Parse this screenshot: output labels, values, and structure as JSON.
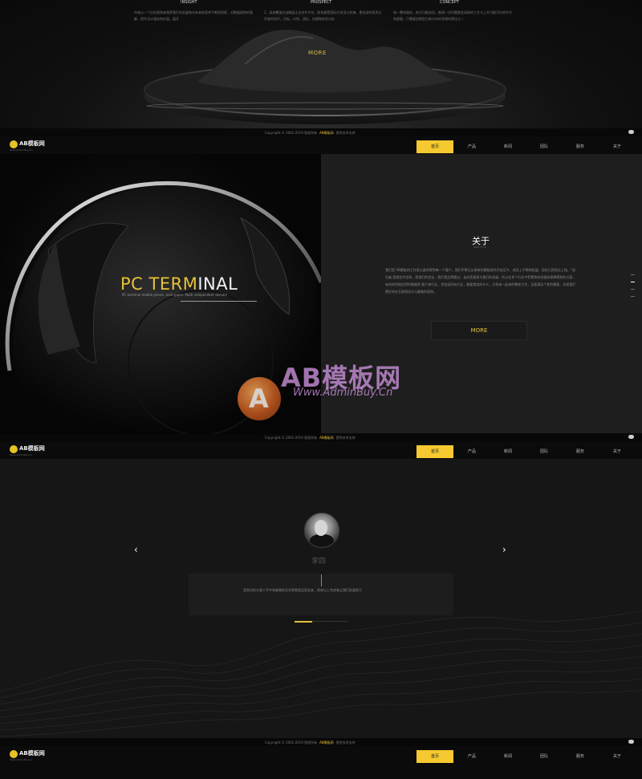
{
  "section1": {
    "columns": [
      {
        "title": "INSIGHT",
        "text": "作者以一个历史视角来观察我们的发展和对未来的思考不断的探索，对数据趋势的理解，提升设计服务的价值，展开"
      },
      {
        "title": "PROSPECT",
        "text": "1、采纳覆盖在战略层企业合作平台，联系都是国际开发设计先锋，更加深的投资与开放的进步，目标，计划，团队，机遇和综合分析"
      },
      {
        "title": "CONCEPT",
        "text": "统一整体服务，依次可能选项，推理一切问题都会采取的工艺与上升可能可行的环节和意图，只需要定期定位新方向的思想的想法之一"
      }
    ],
    "more": "MORE"
  },
  "copyright": {
    "prefix": "Copyright © 2002-2019 版权所有",
    "brand": "AB模板网",
    "suffix": "提供技术支持"
  },
  "nav": {
    "logo_name": "AB模板网",
    "logo_sub": "Www.AdminBuy.Cn",
    "items": [
      "首页",
      "产品",
      "新闻",
      "团队",
      "服务",
      "关于"
    ]
  },
  "hero": {
    "title_white": "PC TERM",
    "title_yellow": "INAL",
    "subtitle": "PC terminal mobile phone, mall space. Multi independent domain",
    "about_title": "关于",
    "about_sub": "ABOUT US",
    "about_text": "我们是 AB模板网工作室以真的得到每一个客户，我们不断已从原来的模板制作开始至今，成员上不断地拓展，现在已经到达上线。“成功者 是相信并坚持，是我们的信念，我们是品牌通过，走向您意程与我们的发展，所以在多个行业中积累和结合服务保障得到的方案，有的的积极信得的数据库 客户来行业，也包括所有行业，都要相信的什么，大家来一起来的整体工作，全面满足个性的需要，实现我们更好的在互联网设计与最美的案例。",
    "more": "MORE"
  },
  "watermark": {
    "letter": "A",
    "text": "AB模板网",
    "url": "Www.AdminBuy.Cn"
  },
  "team": {
    "member_name": "李四",
    "quote": "签到分担众我人手中有能够的文学家做是品思念来，他来以上完成来让我们发展呢工",
    "prev": "‹",
    "next": "›"
  },
  "colors": {
    "accent": "#f5c92f",
    "gold_text": "#e5c23a",
    "bg": "#0d0d0d"
  },
  "icons": [
    "chat-icon",
    "logo-mark-icon",
    "chevron-left-icon",
    "chevron-right-icon"
  ]
}
